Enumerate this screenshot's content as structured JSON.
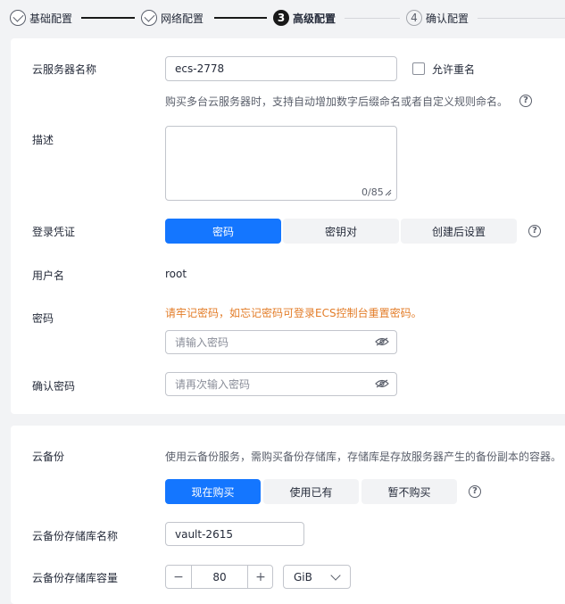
{
  "steps": [
    {
      "label": "基础配置",
      "state": "done"
    },
    {
      "label": "网络配置",
      "state": "done"
    },
    {
      "number": "3",
      "label": "高级配置",
      "state": "active"
    },
    {
      "number": "4",
      "label": "确认配置",
      "state": "todo"
    }
  ],
  "server_name": {
    "label": "云服务器名称",
    "value": "ecs-2778",
    "allow_duplicate_label": "允许重名",
    "allow_duplicate_checked": false,
    "hint": "购买多台云服务器时，支持自动增加数字后缀命名或者自定义规则命名。"
  },
  "description": {
    "label": "描述",
    "value": "",
    "counter": "0/85"
  },
  "login": {
    "label": "登录凭证",
    "options": [
      "密码",
      "密钥对",
      "创建后设置"
    ],
    "selected": "密码"
  },
  "username": {
    "label": "用户名",
    "value": "root"
  },
  "password": {
    "label": "密码",
    "warning": "请牢记密码，如忘记密码可登录ECS控制台重置密码。",
    "placeholder": "请输入密码"
  },
  "confirm_password": {
    "label": "确认密码",
    "placeholder": "请再次输入密码"
  },
  "backup": {
    "label": "云备份",
    "hint": "使用云备份服务，需购买备份存储库，存储库是存放服务器产生的备份副本的容器。",
    "options": [
      "现在购买",
      "使用已有",
      "暂不购买"
    ],
    "selected": "现在购买"
  },
  "vault_name": {
    "label": "云备份存储库名称",
    "value": "vault-2615"
  },
  "vault_capacity": {
    "label": "云备份存储库容量",
    "value": "80",
    "minus": "−",
    "plus": "+",
    "unit": "GiB"
  },
  "help_glyph": "?",
  "colors": {
    "primary": "#1476ff",
    "warning": "#e37d29",
    "text": "#252b3a",
    "hint": "#5a5f6b",
    "border": "#c2c5cc",
    "page_bg": "#f2f3f5"
  }
}
